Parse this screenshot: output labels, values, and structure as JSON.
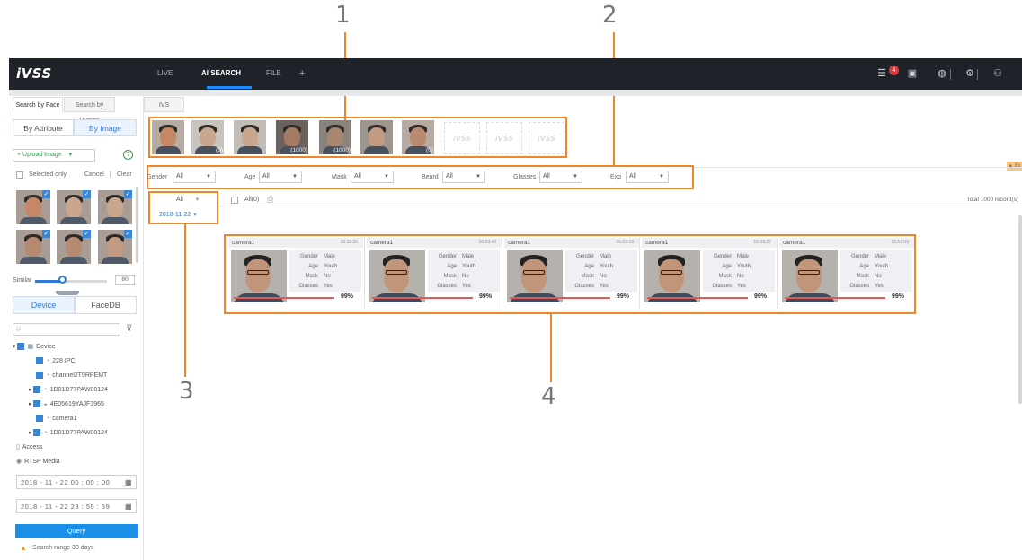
{
  "callouts": [
    "1",
    "2",
    "3",
    "4"
  ],
  "header": {
    "logo": "iVSS",
    "nav": [
      "LIVE",
      "AI SEARCH",
      "FILE",
      "+"
    ],
    "badge_count": "4"
  },
  "left": {
    "tabs": [
      "Search by Face",
      "Search by Human",
      "IVS"
    ],
    "mode_tabs": [
      "By Attribute",
      "By Image"
    ],
    "upload_label": "Upload Image",
    "selected_only": "Selected only",
    "cancel": "Cancel",
    "clear": "Clear",
    "similar_label": "Similar",
    "similar_value": "80",
    "source_tabs": [
      "Device",
      "FaceDB"
    ],
    "tree": {
      "root": "Device",
      "items": [
        "228 IPC",
        "channel2T9RPEMT",
        "1D01D77PAW00124",
        "4E05619YAJF3965",
        "camera1",
        "1D01D77PAW00124"
      ],
      "access": "Access",
      "rtsp": "RTSP Media"
    },
    "start_time": "2018 - 11 - 22  00 : 00 : 00",
    "end_time": "2018 - 11 - 22  23 : 59 : 59",
    "query": "Query",
    "warning": "Search range 30 days"
  },
  "face_strip": {
    "counts": [
      "",
      "(0)",
      "",
      "(1000)",
      "(1000)",
      "",
      "(0)"
    ],
    "placeholder": "iVSS"
  },
  "filters": [
    {
      "label": "Gender",
      "value": "All"
    },
    {
      "label": "Age",
      "value": "All"
    },
    {
      "label": "Mask",
      "value": "All"
    },
    {
      "label": "Beard",
      "value": "All"
    },
    {
      "label": "Glasses",
      "value": "All"
    },
    {
      "label": "Exp",
      "value": "All"
    }
  ],
  "export_label": "▲ Ex",
  "date_list": {
    "all": "All",
    "date": "2018-11-22"
  },
  "toolbar": {
    "all_label": "All(0)"
  },
  "total": "Total 1000 record(s)",
  "results": [
    {
      "camera": "camera1",
      "time": "16:13:20",
      "gender": "Male",
      "age": "Youth",
      "mask": "No",
      "glasses": "Yes",
      "similarity": "99%"
    },
    {
      "camera": "camera1",
      "time": "16:03:40",
      "gender": "Male",
      "age": "Youth",
      "mask": "No",
      "glasses": "Yes",
      "similarity": "99%"
    },
    {
      "camera": "camera1",
      "time": "16:03:18",
      "gender": "Male",
      "age": "Youth",
      "mask": "No",
      "glasses": "Yes",
      "similarity": "99%"
    },
    {
      "camera": "camera1",
      "time": "15:59:27",
      "gender": "Male",
      "age": "Youth",
      "mask": "No",
      "glasses": "Yes",
      "similarity": "99%"
    },
    {
      "camera": "camera1",
      "time": "15:57:09",
      "gender": "Male",
      "age": "Youth",
      "mask": "No",
      "glasses": "Yes",
      "similarity": "99%"
    }
  ],
  "attr_labels": {
    "gender": "Gender",
    "age": "Age",
    "mask": "Mask",
    "glasses": "Glasses"
  },
  "colors": {
    "accent": "#2f7ad9",
    "callout": "#f0862a",
    "topbar": "#1f2329",
    "badge": "#e03b3b"
  }
}
